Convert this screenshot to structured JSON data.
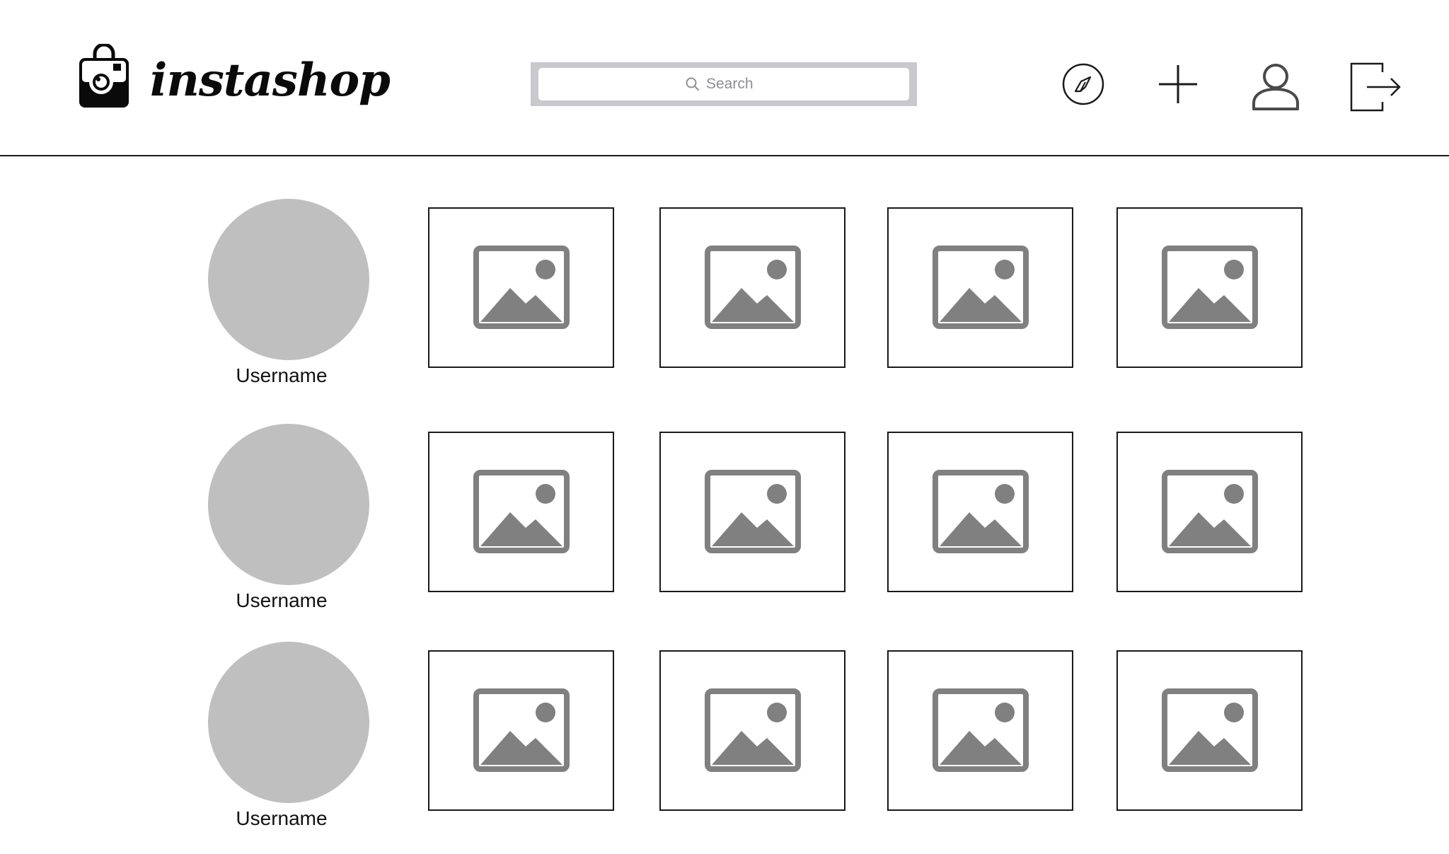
{
  "brand": {
    "name": "instashop"
  },
  "search": {
    "placeholder": "Search"
  },
  "nav": [
    {
      "name": "explore",
      "icon": "compass-icon"
    },
    {
      "name": "add-post",
      "icon": "plus-icon"
    },
    {
      "name": "profile",
      "icon": "user-icon"
    },
    {
      "name": "logout",
      "icon": "logout-icon"
    }
  ],
  "feed": {
    "rows": [
      {
        "username": "Username",
        "posts": [
          "image-placeholder-icon",
          "image-placeholder-icon",
          "image-placeholder-icon",
          "image-placeholder-icon"
        ]
      },
      {
        "username": "Username",
        "posts": [
          "image-placeholder-icon",
          "image-placeholder-icon",
          "image-placeholder-icon",
          "image-placeholder-icon"
        ]
      },
      {
        "username": "Username",
        "posts": [
          "image-placeholder-icon",
          "image-placeholder-icon",
          "image-placeholder-icon",
          "image-placeholder-icon"
        ]
      }
    ]
  },
  "colors": {
    "avatar": "#bfbfbf",
    "placeholder": "#808080",
    "search_frame": "#c8c8cd",
    "line": "#1a1a1a"
  }
}
